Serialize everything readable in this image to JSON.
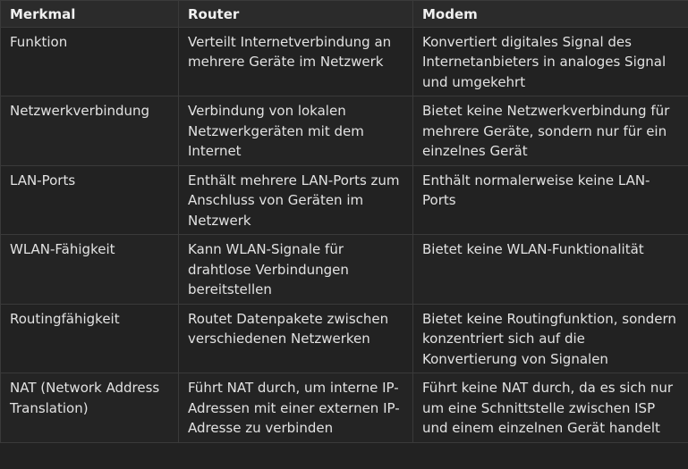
{
  "table": {
    "headers": [
      "Merkmal",
      "Router",
      "Modem"
    ],
    "rows": [
      [
        "Funktion",
        "Verteilt Internetverbindung an mehrere Geräte im Netzwerk",
        "Konvertiert digitales Signal des Internetanbieters in analoges Signal und umgekehrt"
      ],
      [
        "Netzwerkverbindung",
        "Verbindung von lokalen Netzwerkgeräten mit dem Internet",
        "Bietet keine Netzwerkverbindung für mehrere Geräte, sondern nur für ein einzelnes Gerät"
      ],
      [
        "LAN-Ports",
        "Enthält mehrere LAN-Ports zum Anschluss von Geräten im Netzwerk",
        "Enthält normalerweise keine LAN-Ports"
      ],
      [
        "WLAN-Fähigkeit",
        "Kann WLAN-Signale für drahtlose Verbindungen bereitstellen",
        "Bietet keine WLAN-Funktionalität"
      ],
      [
        "Routingfähigkeit",
        "Routet Datenpakete zwischen verschiedenen Netzwerken",
        "Bietet keine Routingfunktion, sondern konzentriert sich auf die Konvertierung von Signalen"
      ],
      [
        "NAT (Network Address Translation)",
        "Führt NAT durch, um interne IP-Adressen mit einer externen IP-Adresse zu verbinden",
        "Führt keine NAT durch, da es sich nur um eine Schnittstelle zwischen ISP und einem einzelnen Gerät handelt"
      ]
    ]
  }
}
